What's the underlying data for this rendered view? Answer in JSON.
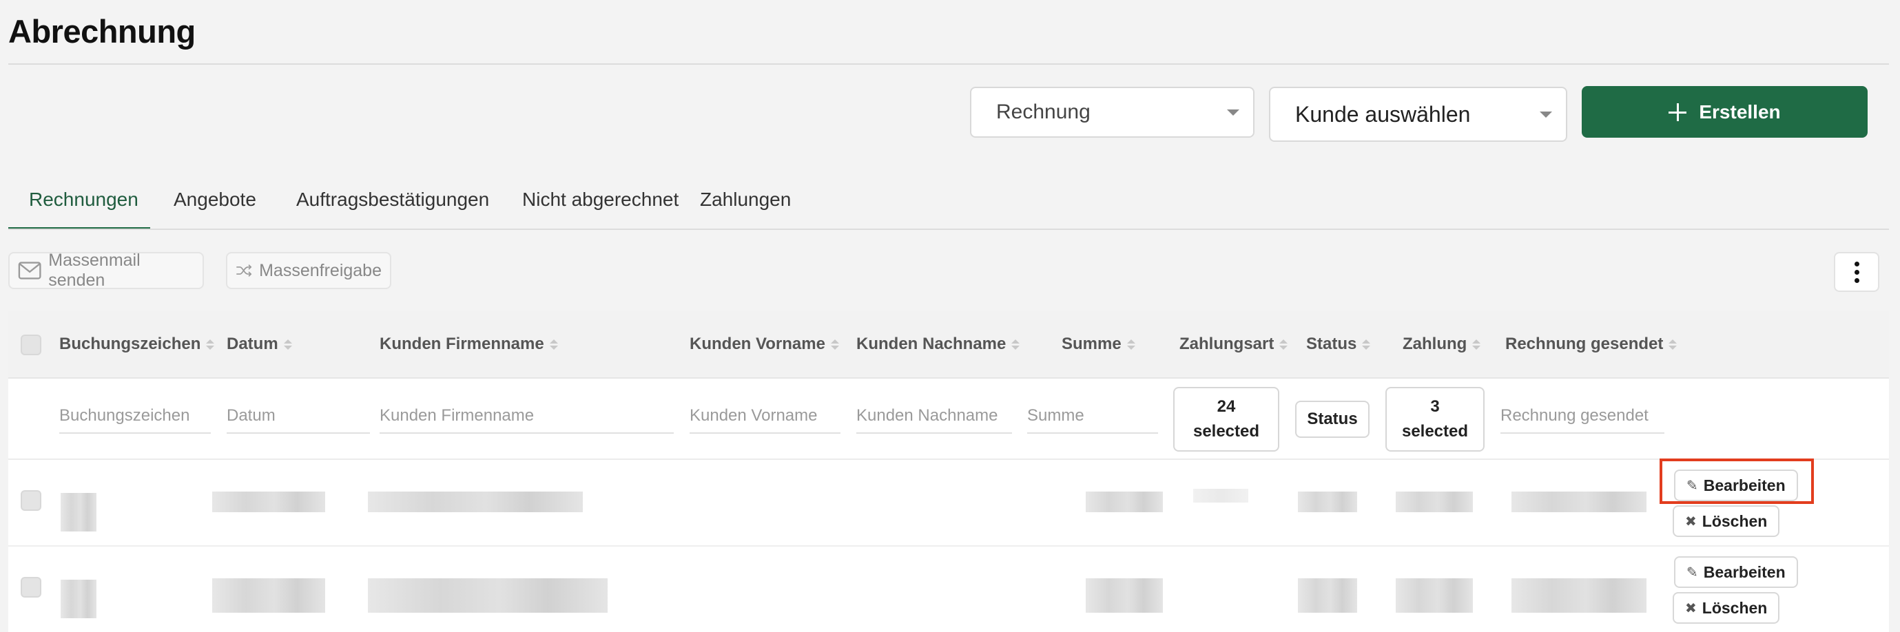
{
  "page": {
    "title": "Abrechnung"
  },
  "filters": {
    "document_type": "Rechnung",
    "customer_placeholder": "Kunde auswählen",
    "create_label": "Erstellen"
  },
  "tabs": [
    {
      "label": "Rechnungen",
      "active": true
    },
    {
      "label": "Angebote",
      "active": false
    },
    {
      "label": "Auftragsbestätigungen",
      "active": false
    },
    {
      "label": "Nicht abgerechnet",
      "active": false
    },
    {
      "label": "Zahlungen",
      "active": false
    }
  ],
  "toolbar": {
    "mass_mail": {
      "label": "Massenmail senden",
      "icon": "envelope-icon"
    },
    "mass_release": {
      "label": "Massenfreigabe",
      "icon": "shuffle-icon"
    },
    "more_icon": "kebab-menu-icon"
  },
  "table": {
    "columns": [
      "Buchungszeichen",
      "Datum",
      "Kunden Firmenname",
      "Kunden Vorname",
      "Kunden Nachname",
      "Summe",
      "Zahlungsart",
      "Status",
      "Zahlung",
      "Rechnung gesendet"
    ],
    "filter_placeholders": {
      "buchungszeichen": "Buchungszeichen",
      "datum": "Datum",
      "firmenname": "Kunden Firmenname",
      "vorname": "Kunden Vorname",
      "nachname": "Kunden Nachname",
      "summe": "Summe",
      "gesendet": "Rechnung gesendet"
    },
    "filter_buttons": {
      "zahlungsart": {
        "count": "24",
        "suffix": "selected"
      },
      "status": "Status",
      "zahlung": {
        "count": "3",
        "suffix": "selected"
      }
    },
    "row_actions": {
      "edit": "Bearbeiten",
      "delete": "Löschen"
    },
    "rows_visible": 2
  },
  "colors": {
    "accent": "#1f6b45",
    "highlight": "#e23d1e"
  }
}
